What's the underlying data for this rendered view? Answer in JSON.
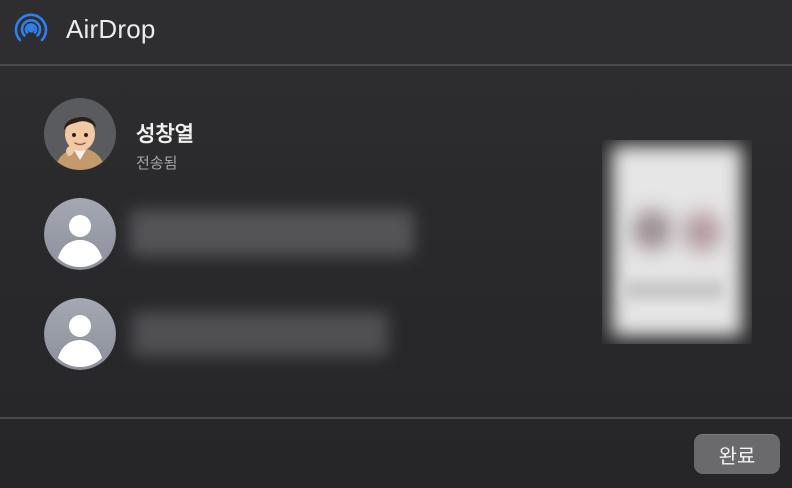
{
  "window": {
    "title": "AirDrop",
    "icon": "airdrop-icon",
    "accent": "#2f80ed"
  },
  "recipients": [
    {
      "name": "성창열",
      "status": "전송됨",
      "avatar": "memoji-avatar"
    },
    {
      "name": "",
      "status": "",
      "avatar": "default-person-avatar"
    },
    {
      "name": "",
      "status": "",
      "avatar": "default-person-avatar"
    }
  ],
  "footer": {
    "done_label": "완료"
  }
}
